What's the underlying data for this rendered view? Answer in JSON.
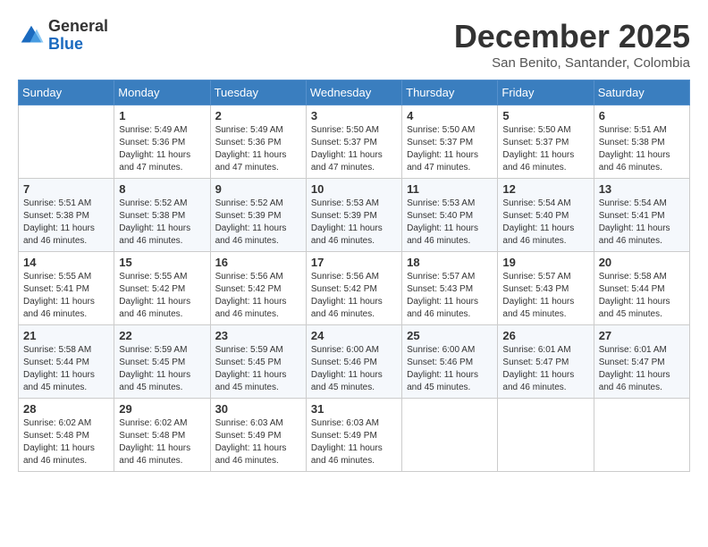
{
  "logo": {
    "general": "General",
    "blue": "Blue"
  },
  "header": {
    "month": "December 2025",
    "location": "San Benito, Santander, Colombia"
  },
  "weekdays": [
    "Sunday",
    "Monday",
    "Tuesday",
    "Wednesday",
    "Thursday",
    "Friday",
    "Saturday"
  ],
  "weeks": [
    [
      {
        "day": "",
        "info": ""
      },
      {
        "day": "1",
        "info": "Sunrise: 5:49 AM\nSunset: 5:36 PM\nDaylight: 11 hours\nand 47 minutes."
      },
      {
        "day": "2",
        "info": "Sunrise: 5:49 AM\nSunset: 5:36 PM\nDaylight: 11 hours\nand 47 minutes."
      },
      {
        "day": "3",
        "info": "Sunrise: 5:50 AM\nSunset: 5:37 PM\nDaylight: 11 hours\nand 47 minutes."
      },
      {
        "day": "4",
        "info": "Sunrise: 5:50 AM\nSunset: 5:37 PM\nDaylight: 11 hours\nand 47 minutes."
      },
      {
        "day": "5",
        "info": "Sunrise: 5:50 AM\nSunset: 5:37 PM\nDaylight: 11 hours\nand 46 minutes."
      },
      {
        "day": "6",
        "info": "Sunrise: 5:51 AM\nSunset: 5:38 PM\nDaylight: 11 hours\nand 46 minutes."
      }
    ],
    [
      {
        "day": "7",
        "info": "Sunrise: 5:51 AM\nSunset: 5:38 PM\nDaylight: 11 hours\nand 46 minutes."
      },
      {
        "day": "8",
        "info": "Sunrise: 5:52 AM\nSunset: 5:38 PM\nDaylight: 11 hours\nand 46 minutes."
      },
      {
        "day": "9",
        "info": "Sunrise: 5:52 AM\nSunset: 5:39 PM\nDaylight: 11 hours\nand 46 minutes."
      },
      {
        "day": "10",
        "info": "Sunrise: 5:53 AM\nSunset: 5:39 PM\nDaylight: 11 hours\nand 46 minutes."
      },
      {
        "day": "11",
        "info": "Sunrise: 5:53 AM\nSunset: 5:40 PM\nDaylight: 11 hours\nand 46 minutes."
      },
      {
        "day": "12",
        "info": "Sunrise: 5:54 AM\nSunset: 5:40 PM\nDaylight: 11 hours\nand 46 minutes."
      },
      {
        "day": "13",
        "info": "Sunrise: 5:54 AM\nSunset: 5:41 PM\nDaylight: 11 hours\nand 46 minutes."
      }
    ],
    [
      {
        "day": "14",
        "info": "Sunrise: 5:55 AM\nSunset: 5:41 PM\nDaylight: 11 hours\nand 46 minutes."
      },
      {
        "day": "15",
        "info": "Sunrise: 5:55 AM\nSunset: 5:42 PM\nDaylight: 11 hours\nand 46 minutes."
      },
      {
        "day": "16",
        "info": "Sunrise: 5:56 AM\nSunset: 5:42 PM\nDaylight: 11 hours\nand 46 minutes."
      },
      {
        "day": "17",
        "info": "Sunrise: 5:56 AM\nSunset: 5:42 PM\nDaylight: 11 hours\nand 46 minutes."
      },
      {
        "day": "18",
        "info": "Sunrise: 5:57 AM\nSunset: 5:43 PM\nDaylight: 11 hours\nand 46 minutes."
      },
      {
        "day": "19",
        "info": "Sunrise: 5:57 AM\nSunset: 5:43 PM\nDaylight: 11 hours\nand 45 minutes."
      },
      {
        "day": "20",
        "info": "Sunrise: 5:58 AM\nSunset: 5:44 PM\nDaylight: 11 hours\nand 45 minutes."
      }
    ],
    [
      {
        "day": "21",
        "info": "Sunrise: 5:58 AM\nSunset: 5:44 PM\nDaylight: 11 hours\nand 45 minutes."
      },
      {
        "day": "22",
        "info": "Sunrise: 5:59 AM\nSunset: 5:45 PM\nDaylight: 11 hours\nand 45 minutes."
      },
      {
        "day": "23",
        "info": "Sunrise: 5:59 AM\nSunset: 5:45 PM\nDaylight: 11 hours\nand 45 minutes."
      },
      {
        "day": "24",
        "info": "Sunrise: 6:00 AM\nSunset: 5:46 PM\nDaylight: 11 hours\nand 45 minutes."
      },
      {
        "day": "25",
        "info": "Sunrise: 6:00 AM\nSunset: 5:46 PM\nDaylight: 11 hours\nand 45 minutes."
      },
      {
        "day": "26",
        "info": "Sunrise: 6:01 AM\nSunset: 5:47 PM\nDaylight: 11 hours\nand 46 minutes."
      },
      {
        "day": "27",
        "info": "Sunrise: 6:01 AM\nSunset: 5:47 PM\nDaylight: 11 hours\nand 46 minutes."
      }
    ],
    [
      {
        "day": "28",
        "info": "Sunrise: 6:02 AM\nSunset: 5:48 PM\nDaylight: 11 hours\nand 46 minutes."
      },
      {
        "day": "29",
        "info": "Sunrise: 6:02 AM\nSunset: 5:48 PM\nDaylight: 11 hours\nand 46 minutes."
      },
      {
        "day": "30",
        "info": "Sunrise: 6:03 AM\nSunset: 5:49 PM\nDaylight: 11 hours\nand 46 minutes."
      },
      {
        "day": "31",
        "info": "Sunrise: 6:03 AM\nSunset: 5:49 PM\nDaylight: 11 hours\nand 46 minutes."
      },
      {
        "day": "",
        "info": ""
      },
      {
        "day": "",
        "info": ""
      },
      {
        "day": "",
        "info": ""
      }
    ]
  ]
}
